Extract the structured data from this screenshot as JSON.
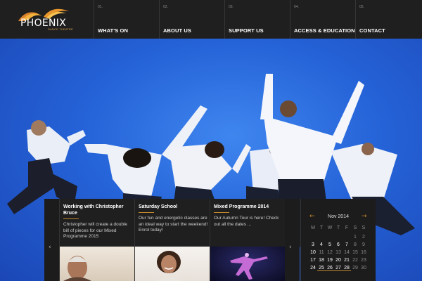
{
  "brand": {
    "name": "PHOENIX",
    "tagline": "DANCE THEATRE",
    "accent_color": "#c0862c",
    "icon": "flame-wing-logo"
  },
  "nav": [
    {
      "num": "01.",
      "label": "WHAT'S ON"
    },
    {
      "num": "02.",
      "label": "ABOUT US"
    },
    {
      "num": "03.",
      "label": "SUPPORT US"
    },
    {
      "num": "04.",
      "label": "ACCESS & EDUCATION"
    },
    {
      "num": "05.",
      "label": "CONTACT"
    }
  ],
  "hero": {
    "image": "dancers-leaping-on-blue-background",
    "background_color": "#2563d8"
  },
  "news": {
    "prev_icon": "chevron-left-icon",
    "next_icon": "chevron-right-icon",
    "items": [
      {
        "title": "Working with Christopher Bruce",
        "text": "Christopher will create a double bill of pieces for our Mixed Programme 2015",
        "image": "portrait-christopher-bruce"
      },
      {
        "title": "Saturday School",
        "text": "Our fun and energetic classes are an ideal way to start the weekend! Enrol today!",
        "image": "smiling-student-portrait"
      },
      {
        "title": "Mixed Programme 2014",
        "text": "Our Autumn Tour is here! Check out all the dates ...",
        "image": "dancer-on-stage-purple-light"
      }
    ]
  },
  "calendar": {
    "month": "Nov 2014",
    "prev_icon": "arrow-left-icon",
    "next_icon": "arrow-right-icon",
    "weekdays": [
      "M",
      "T",
      "W",
      "T",
      "F",
      "S",
      "S"
    ],
    "rows": [
      [
        "",
        "",
        "",
        "",
        "",
        "1",
        "2"
      ],
      [
        "3",
        "4",
        "5",
        "6",
        "7",
        "8",
        "9"
      ],
      [
        "10",
        "11",
        "12",
        "13",
        "14",
        "15",
        "16"
      ],
      [
        "17",
        "18",
        "19",
        "20",
        "21",
        "22",
        "23"
      ],
      [
        "24",
        "25",
        "26",
        "27",
        "28",
        "29",
        "30"
      ]
    ],
    "event_days": [
      "25",
      "26",
      "27",
      "28"
    ]
  }
}
